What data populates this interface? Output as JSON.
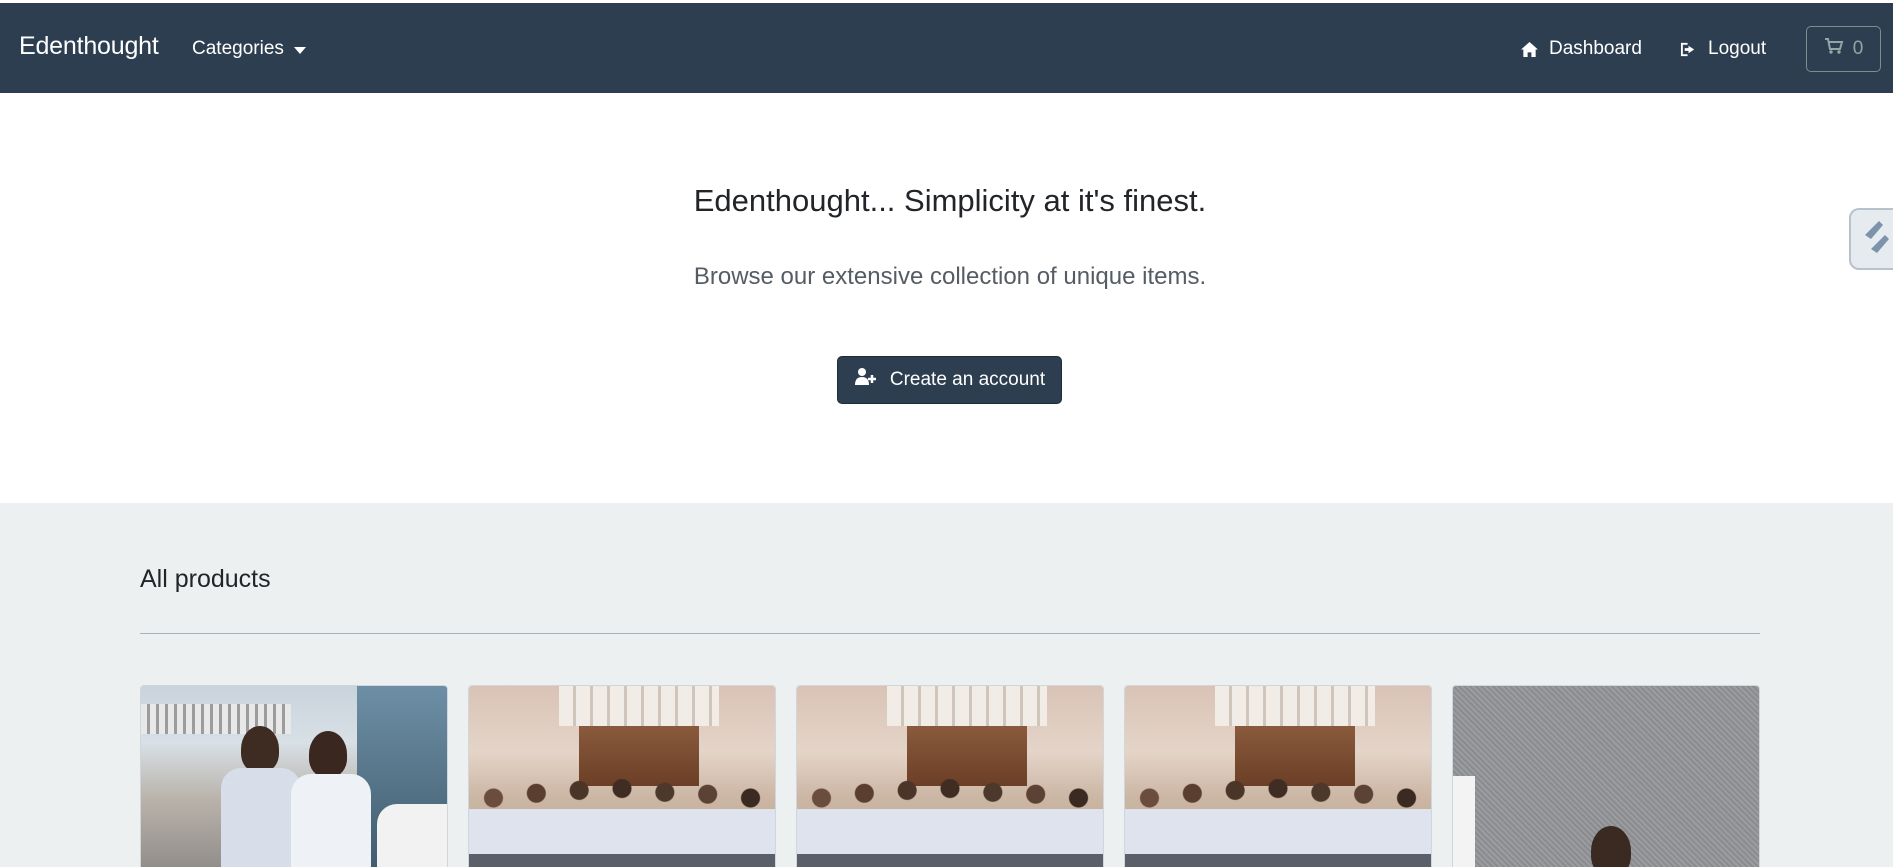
{
  "navbar": {
    "brand": "Edenthought",
    "categories_label": "Categories",
    "dashboard_label": "Dashboard",
    "logout_label": "Logout",
    "cart_count": "0"
  },
  "hero": {
    "title": "Edenthought... Simplicity at it's finest.",
    "subtitle": "Browse our extensive collection of unique items.",
    "create_account_label": "Create an account"
  },
  "products": {
    "heading": "All products",
    "items": [
      {
        "image": "two-people-photo"
      },
      {
        "image": "group-photo"
      },
      {
        "image": "group-photo"
      },
      {
        "image": "group-photo"
      },
      {
        "image": "single-person-photo"
      }
    ]
  },
  "colors": {
    "navbar_bg": "#2c3e50",
    "section_bg": "#ecf0f1",
    "button_bg": "#2c3e50"
  }
}
